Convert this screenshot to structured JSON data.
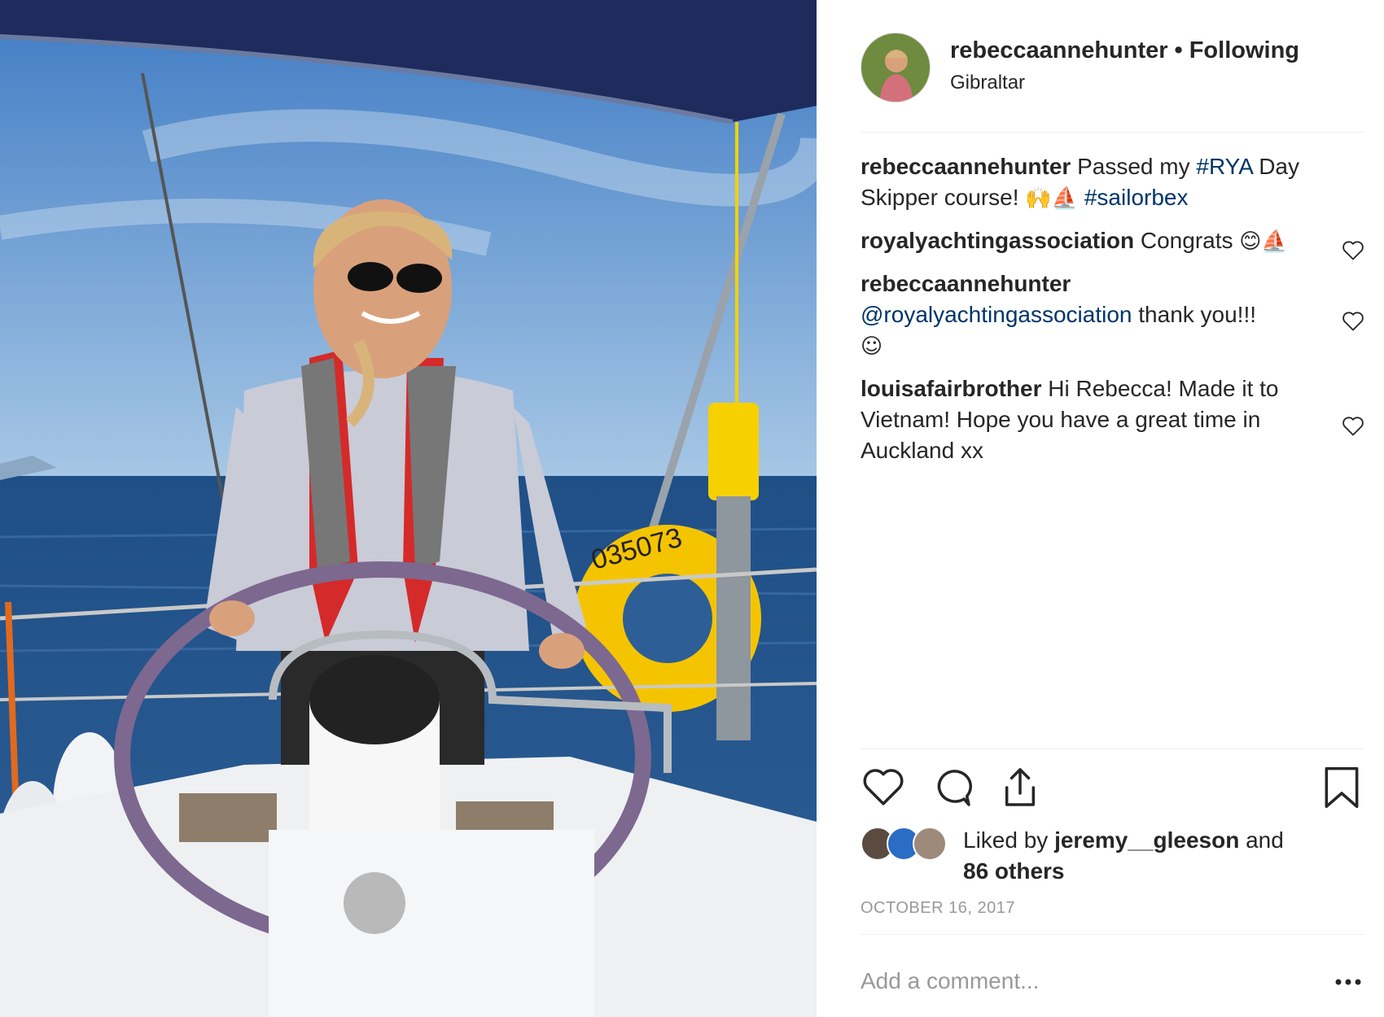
{
  "header": {
    "username": "rebeccaannehunter",
    "separator": "•",
    "follow_state": "Following",
    "location": "Gibraltar"
  },
  "caption": {
    "user": "rebeccaannehunter",
    "text_before": "Passed my",
    "hashtag1": "#RYA",
    "text_after": "Day Skipper course!",
    "emoji": "🙌⛵",
    "hashtag2": "#sailorbex"
  },
  "comments": [
    {
      "user": "royalyachtingassociation",
      "text": "Congrats",
      "emoji": "😊⛵"
    },
    {
      "user": "rebeccaannehunter",
      "mention": "@royalyachtingassociation",
      "text": "thank you!!!",
      "emoji": "☺"
    },
    {
      "user": "louisafairbrother",
      "text": "Hi Rebecca! Made it to Vietnam! Hope you have a great time in Auckland xx"
    }
  ],
  "actions": {
    "like_icon": "heart-icon",
    "comment_icon": "comment-bubble-icon",
    "share_icon": "share-icon",
    "save_icon": "bookmark-icon"
  },
  "likes": {
    "prefix": "Liked by",
    "user": "jeremy__gleeson",
    "conj": "and",
    "others": "86 others"
  },
  "date": "OCTOBER 16, 2017",
  "add_comment": {
    "placeholder": "Add a comment..."
  },
  "more_icon": "more-options-icon",
  "colors": {
    "link": "#003569",
    "muted": "#999999",
    "text": "#262626"
  }
}
